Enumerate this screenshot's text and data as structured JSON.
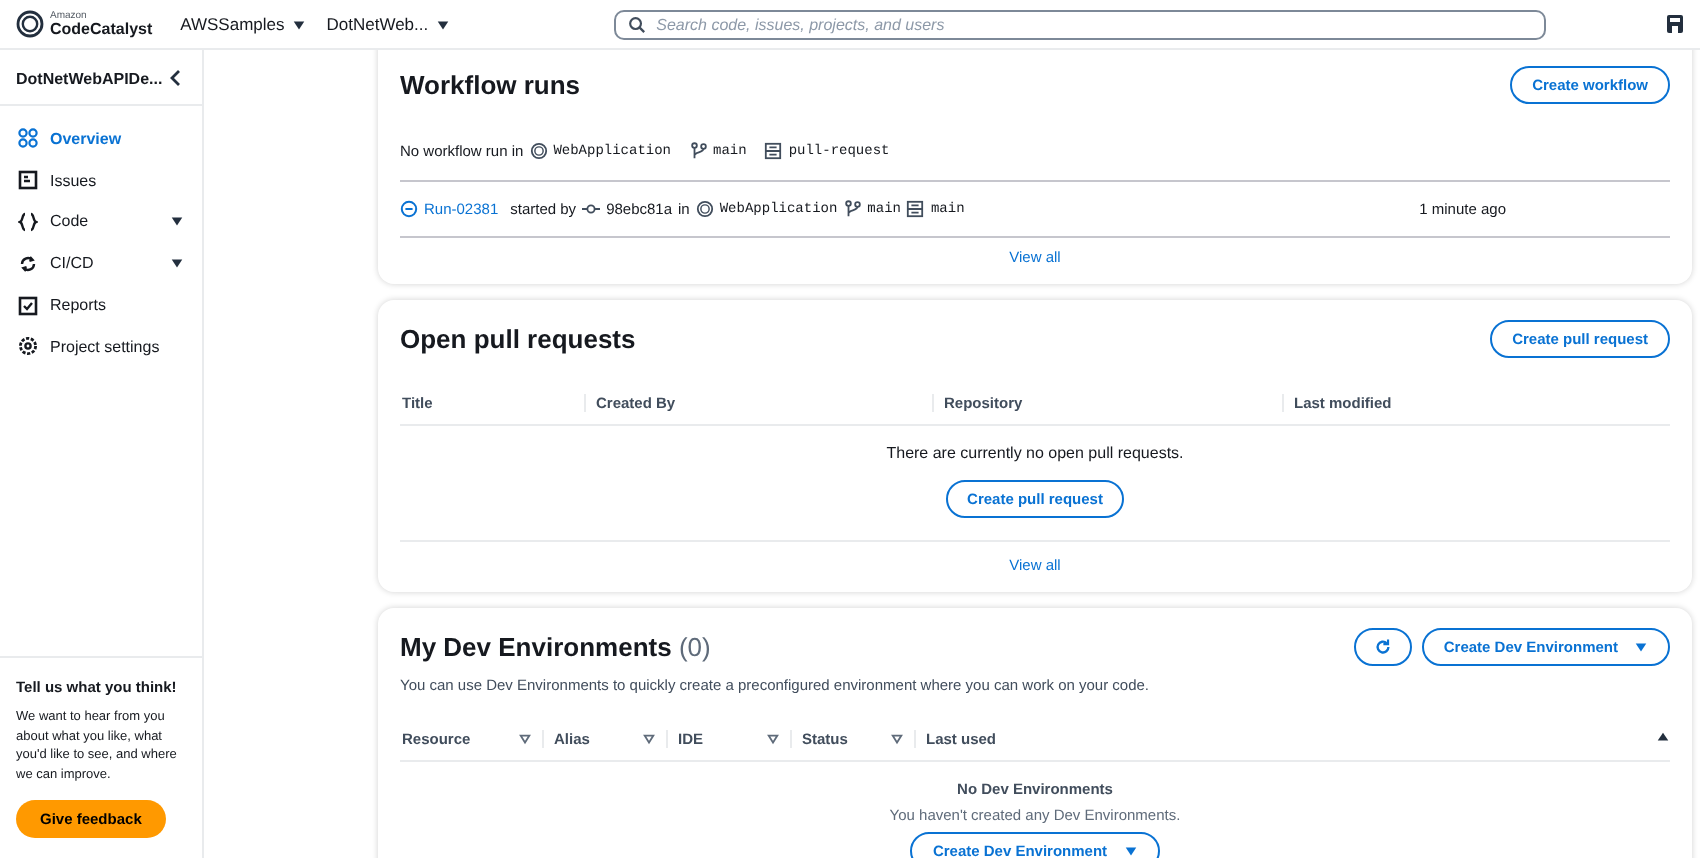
{
  "header": {
    "logo": {
      "maker": "Amazon",
      "product": "CodeCatalyst"
    },
    "breadcrumbs": [
      {
        "label": "AWSSamples"
      },
      {
        "label": "DotNetWeb..."
      }
    ],
    "search": {
      "placeholder": "Search code, issues, projects, and users"
    }
  },
  "sidebar": {
    "project": "DotNetWebAPIDe...",
    "items": [
      {
        "label": "Overview",
        "kind": "overview",
        "selected": true,
        "expandable": false
      },
      {
        "label": "Issues",
        "kind": "issues",
        "selected": false,
        "expandable": false
      },
      {
        "label": "Code",
        "kind": "code",
        "selected": false,
        "expandable": true
      },
      {
        "label": "CI/CD",
        "kind": "cicd",
        "selected": false,
        "expandable": true
      },
      {
        "label": "Reports",
        "kind": "reports",
        "selected": false,
        "expandable": false
      },
      {
        "label": "Project settings",
        "kind": "settings",
        "selected": false,
        "expandable": false
      }
    ],
    "feedback": {
      "title": "Tell us what you think!",
      "text": "We want to hear from you about what you like, what you'd like to see, and where we can improve.",
      "button": "Give feedback"
    }
  },
  "workflow_runs": {
    "title": "Workflow runs",
    "button": "Create workflow",
    "trigger": {
      "text": "No workflow run in",
      "repository": "WebApplication",
      "branch": "main",
      "workflow": "pull-request"
    },
    "runs": [
      {
        "run_id": "Run-02381",
        "started_by": "started by",
        "commit": "98ebc81a",
        "in": "in",
        "repository": "WebApplication",
        "branch": "main",
        "workflow": "main",
        "time": "1 minute ago"
      }
    ],
    "view_all": "View all"
  },
  "pull_requests": {
    "title": "Open pull requests",
    "button": "Create pull request",
    "columns": [
      "Title",
      "Created By",
      "Repository",
      "Last modified"
    ],
    "empty_message": "There are currently no open pull requests.",
    "empty_button": "Create pull request",
    "view_all": "View all"
  },
  "dev_environments": {
    "title": "My Dev Environments",
    "count": "(0)",
    "button": "Create Dev Environment",
    "description": "You can use Dev Environments to quickly create a preconfigured environment where you can work on your code.",
    "columns": [
      {
        "label": "Resource",
        "filterable": true
      },
      {
        "label": "Alias",
        "filterable": true
      },
      {
        "label": "IDE",
        "filterable": true
      },
      {
        "label": "Status",
        "filterable": true
      },
      {
        "label": "Last used",
        "filterable": false
      }
    ],
    "empty_title": "No Dev Environments",
    "empty_text": "You haven't created any Dev Environments.",
    "empty_button": "Create Dev Environment"
  }
}
